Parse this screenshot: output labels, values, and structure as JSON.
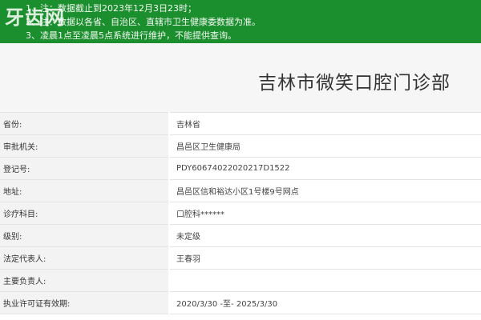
{
  "banner": {
    "watermark": "牙齿网",
    "notes": [
      "1、注：数据截止到2023年12月3日23时；",
      "2、注：数据以各省、自治区、直辖市卫生健康委数据为准。",
      "3、凌晨1点至凌晨5点系统进行维护，不能提供查询。"
    ],
    "color": "#1b8e2d"
  },
  "page_title": "吉林市微笑口腔门诊部",
  "fields": [
    {
      "label": "省份:",
      "value": "吉林省"
    },
    {
      "label": "审批机关:",
      "value": "昌邑区卫生健康局"
    },
    {
      "label": "登记号:",
      "value": "PDY60674022020217D1522"
    },
    {
      "label": "地址:",
      "value": "昌邑区信和裕达小区1号楼9号网点"
    },
    {
      "label": "诊疗科目:",
      "value": "口腔科******"
    },
    {
      "label": "级别:",
      "value": "未定级"
    },
    {
      "label": "法定代表人:",
      "value": "王春羽"
    },
    {
      "label": "主要负责人:",
      "value": ""
    },
    {
      "label": "执业许可证有效期:",
      "value": "2020/3/30 -至- 2025/3/30"
    }
  ]
}
